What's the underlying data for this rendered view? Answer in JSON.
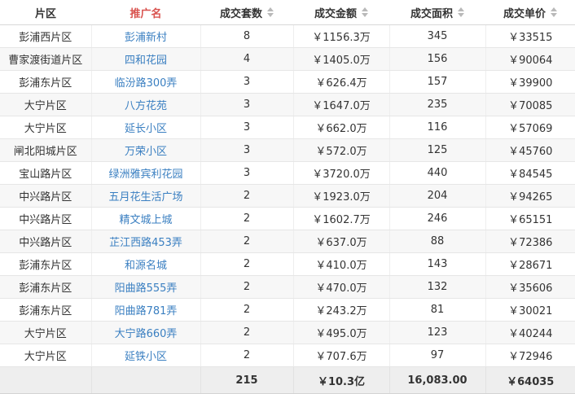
{
  "headers": [
    {
      "label": "片区",
      "sortable": false
    },
    {
      "label": "推广名",
      "sortable": false
    },
    {
      "label": "成交套数",
      "sortable": true
    },
    {
      "label": "成交金额",
      "sortable": true
    },
    {
      "label": "成交面积",
      "sortable": true
    },
    {
      "label": "成交单价",
      "sortable": true
    }
  ],
  "rows": [
    {
      "district": "彭浦西片区",
      "name": "彭浦新村",
      "count": "8",
      "amount": "￥1156.3万",
      "area": "345",
      "price": "￥33515"
    },
    {
      "district": "曹家渡街道片区",
      "name": "四和花园",
      "count": "4",
      "amount": "￥1405.0万",
      "area": "156",
      "price": "￥90064"
    },
    {
      "district": "彭浦东片区",
      "name": "临汾路300弄",
      "count": "3",
      "amount": "￥626.4万",
      "area": "157",
      "price": "￥39900"
    },
    {
      "district": "大宁片区",
      "name": "八方花苑",
      "count": "3",
      "amount": "￥1647.0万",
      "area": "235",
      "price": "￥70085"
    },
    {
      "district": "大宁片区",
      "name": "延长小区",
      "count": "3",
      "amount": "￥662.0万",
      "area": "116",
      "price": "￥57069"
    },
    {
      "district": "闸北阳城片区",
      "name": "万荣小区",
      "count": "3",
      "amount": "￥572.0万",
      "area": "125",
      "price": "￥45760"
    },
    {
      "district": "宝山路片区",
      "name": "绿洲雅宾利花园",
      "count": "3",
      "amount": "￥3720.0万",
      "area": "440",
      "price": "￥84545"
    },
    {
      "district": "中兴路片区",
      "name": "五月花生活广场",
      "count": "2",
      "amount": "￥1923.0万",
      "area": "204",
      "price": "￥94265"
    },
    {
      "district": "中兴路片区",
      "name": "精文城上城",
      "count": "2",
      "amount": "￥1602.7万",
      "area": "246",
      "price": "￥65151"
    },
    {
      "district": "中兴路片区",
      "name": "芷江西路453弄",
      "count": "2",
      "amount": "￥637.0万",
      "area": "88",
      "price": "￥72386"
    },
    {
      "district": "彭浦东片区",
      "name": "和源名城",
      "count": "2",
      "amount": "￥410.0万",
      "area": "143",
      "price": "￥28671"
    },
    {
      "district": "彭浦东片区",
      "name": "阳曲路555弄",
      "count": "2",
      "amount": "￥470.0万",
      "area": "132",
      "price": "￥35606"
    },
    {
      "district": "彭浦东片区",
      "name": "阳曲路781弄",
      "count": "2",
      "amount": "￥243.2万",
      "area": "81",
      "price": "￥30021"
    },
    {
      "district": "大宁片区",
      "name": "大宁路660弄",
      "count": "2",
      "amount": "￥495.0万",
      "area": "123",
      "price": "￥40244"
    },
    {
      "district": "大宁片区",
      "name": "延铁小区",
      "count": "2",
      "amount": "￥707.6万",
      "area": "97",
      "price": "￥72946"
    }
  ],
  "totals": {
    "district": "",
    "name": "",
    "count": "215",
    "amount": "￥10.3亿",
    "area": "16,083.00",
    "price": "￥64035"
  },
  "colors": {
    "link": "#3a7fc1",
    "promo_header": "#d9534f"
  },
  "icons": {
    "sort": "sort-arrows-icon"
  }
}
